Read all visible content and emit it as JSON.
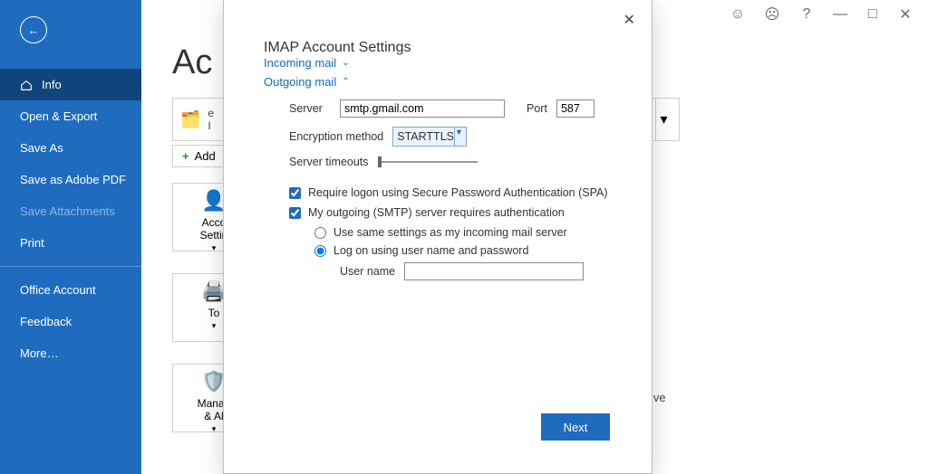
{
  "titlebar": {
    "happy": "☺",
    "sad": "☹",
    "help": "?",
    "min": "—",
    "max": "□",
    "close": "✕"
  },
  "sidebar": {
    "back": "←",
    "items": [
      {
        "label": "Info",
        "selected": true
      },
      {
        "label": "Open & Export"
      },
      {
        "label": "Save As"
      },
      {
        "label": "Save as Adobe PDF"
      },
      {
        "label": "Save Attachments",
        "disabled": true
      },
      {
        "label": "Print"
      }
    ],
    "footer": [
      {
        "label": "Office Account"
      },
      {
        "label": "Feedback"
      },
      {
        "label": "More…"
      }
    ]
  },
  "bg": {
    "heading": "Ac",
    "card1_line1": "e",
    "card1_line2": "I",
    "add": "Add",
    "tiles": [
      {
        "label": "Acco\nSettin"
      },
      {
        "label": "To"
      },
      {
        "label": "Manag\n& Al"
      }
    ],
    "frag": "ive"
  },
  "dialog": {
    "title": "IMAP Account Settings",
    "incoming": "Incoming mail",
    "outgoing": "Outgoing mail",
    "server_lbl": "Server",
    "server_val": "smtp.gmail.com",
    "port_lbl": "Port",
    "port_val": "587",
    "enc_lbl": "Encryption method",
    "enc_val": "STARTTLS",
    "timeout_lbl": "Server timeouts",
    "spa": "Require logon using Secure Password Authentication (SPA)",
    "smtp_auth": "My outgoing (SMTP) server requires authentication",
    "radio_same": "Use same settings as my incoming mail server",
    "radio_logon": "Log on using user name and password",
    "uname_lbl": "User name",
    "uname_val": "",
    "next": "Next"
  }
}
